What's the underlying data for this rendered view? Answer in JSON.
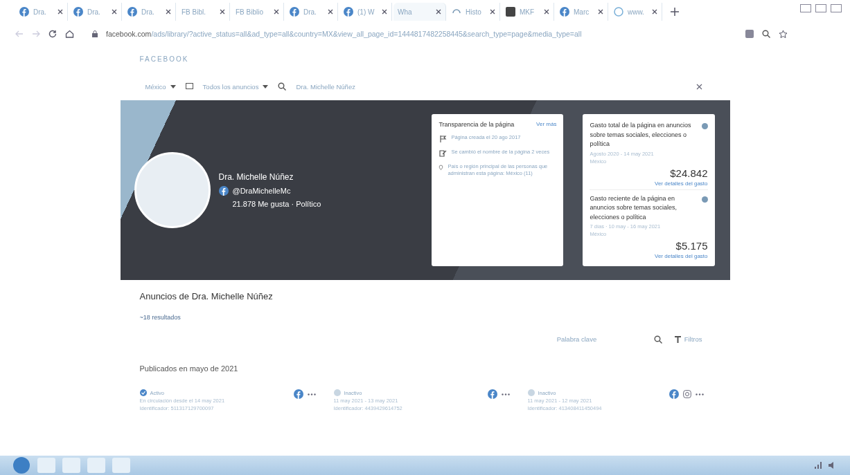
{
  "tabs": [
    {
      "label": "Dra.",
      "kind": "facebook",
      "selected": false
    },
    {
      "label": "Dra.",
      "kind": "facebook",
      "selected": false
    },
    {
      "label": "Dra.",
      "kind": "facebook",
      "selected": false
    },
    {
      "label": "FB Bibl.",
      "kind": "plain",
      "selected": false
    },
    {
      "label": "FB Biblio",
      "kind": "plain",
      "selected": false
    },
    {
      "label": "Dra.",
      "kind": "facebook",
      "selected": false
    },
    {
      "label": "(1) W",
      "kind": "facebook",
      "selected": false
    },
    {
      "label": "Wha",
      "kind": "plain",
      "selected": true
    },
    {
      "label": "Histo",
      "kind": "history",
      "selected": false
    },
    {
      "label": "MKF",
      "kind": "square",
      "selected": false
    },
    {
      "label": "Marc",
      "kind": "facebook",
      "selected": false
    },
    {
      "label": "www.",
      "kind": "globe",
      "selected": false
    }
  ],
  "address_bar": {
    "host": "facebook.com",
    "path": "/ads/library/?active_status=all&ad_type=all&country=MX&view_all_page_id=1444817482258445&search_type=page&media_type=all"
  },
  "brand": "FACEBOOK",
  "filters": {
    "country": "México",
    "ad_type": "Todos los anuncios",
    "query": "Dra. Michelle Núñez"
  },
  "page_header": {
    "name": "Dra. Michelle Núñez",
    "handle": "@DraMichelleMc",
    "stats": "21.878 Me gusta · Político"
  },
  "transparency": {
    "title": "Transparencia de la página",
    "link": "Ver más",
    "items": [
      {
        "kind": "flag",
        "text": "Página creada el 20 ago 2017"
      },
      {
        "kind": "edit",
        "text": "Se cambió el nombre de la página 2 veces"
      },
      {
        "kind": "pin",
        "text": "País o región principal de las personas que administran esta página: México (11)"
      }
    ]
  },
  "spend": [
    {
      "title": "Gasto total de la página en anuncios sobre temas sociales, elecciones o política",
      "period": "Agosto 2020 - 14 may 2021",
      "region": "México",
      "amount": "$24.842",
      "link": "Ver detalles del gasto"
    },
    {
      "title": "Gasto reciente de la página en anuncios sobre temas sociales, elecciones o política",
      "period": "7 días · 10 may - 16 may 2021",
      "region": "México",
      "amount": "$5.175",
      "link": "Ver detalles del gasto"
    }
  ],
  "results": {
    "title": "Anuncios de Dra. Michelle Núñez",
    "count": "~18 resultados",
    "search_placeholder": "Palabra clave",
    "filters_label": "Filtros",
    "section": "Publicados en mayo de 2021"
  },
  "ads": [
    {
      "status": "Activo",
      "active": true,
      "dates": "En circulación desde el 14 may 2021",
      "id": "Identificador: 511317129700097",
      "platforms": [
        {
          "kind": "facebook"
        }
      ]
    },
    {
      "status": "Inactivo",
      "active": false,
      "dates": "11 may 2021 - 13 may 2021",
      "id": "Identificador: 4439429614752",
      "platforms": [
        {
          "kind": "facebook"
        }
      ]
    },
    {
      "status": "Inactivo",
      "active": false,
      "dates": "11 may 2021 - 12 may 2021",
      "id": "Identificador: 413408411450494",
      "platforms": [
        {
          "kind": "facebook"
        },
        {
          "kind": "instagram"
        }
      ]
    }
  ]
}
